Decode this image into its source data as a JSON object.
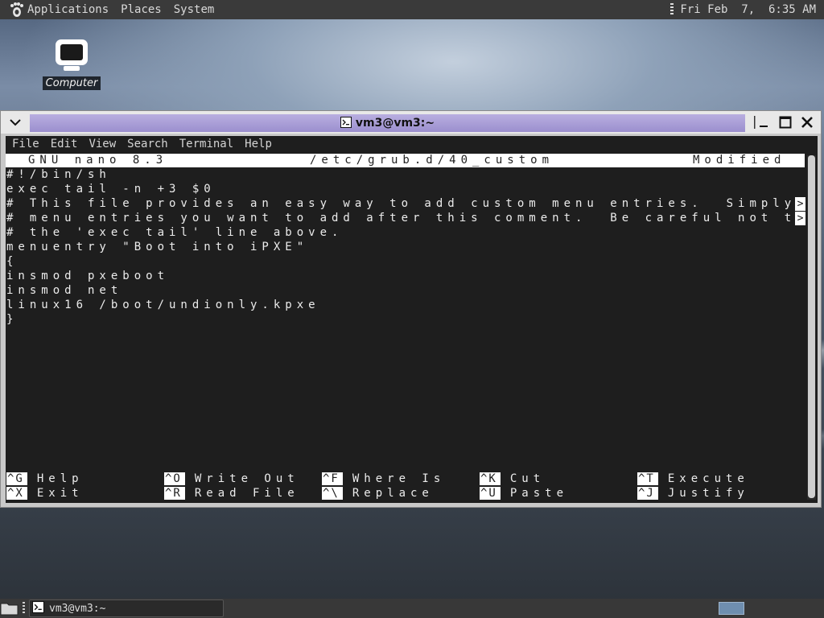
{
  "top_panel": {
    "menus": [
      "Applications",
      "Places",
      "System"
    ],
    "clock": "Fri Feb  7,  6:35 AM",
    "logo_icon": "gnome-foot-icon"
  },
  "desktop": {
    "icons": [
      {
        "label": "Computer",
        "icon": "computer-monitor-icon"
      }
    ]
  },
  "terminal": {
    "title": "vm3@vm3:~",
    "menus": [
      "File",
      "Edit",
      "View",
      "Search",
      "Terminal",
      "Help"
    ],
    "nano": {
      "version": "GNU nano 8.3",
      "filename": "/etc/grub.d/40_custom",
      "status": "Modified",
      "lines": [
        "#!/bin/sh",
        "exec tail -n +3 $0",
        "# This file provides an easy way to add custom menu entries.  Simply t",
        "# menu entries you want to add after this comment.  Be careful not to",
        "# the 'exec tail' line above.",
        "menuentry \"Boot into iPXE\"",
        "{",
        "insmod pxeboot",
        "insmod net",
        "linux16 /boot/undionly.kpxe",
        "}"
      ],
      "wrap_marker": ">",
      "shortcuts_row1": [
        {
          "key": "^G",
          "label": "Help"
        },
        {
          "key": "^O",
          "label": "Write Out"
        },
        {
          "key": "^F",
          "label": "Where Is"
        },
        {
          "key": "^K",
          "label": "Cut"
        },
        {
          "key": "^T",
          "label": "Execute"
        }
      ],
      "shortcuts_row2": [
        {
          "key": "^X",
          "label": "Exit"
        },
        {
          "key": "^R",
          "label": "Read File"
        },
        {
          "key": "^\\",
          "label": "Replace"
        },
        {
          "key": "^U",
          "label": "Paste"
        },
        {
          "key": "^J",
          "label": "Justify"
        }
      ]
    }
  },
  "taskbar": {
    "tasks": [
      {
        "label": "vm3@vm3:~",
        "icon": "terminal-icon"
      }
    ]
  },
  "colors": {
    "terminal_bg": "#1e1e1e",
    "terminal_fg": "#ececec",
    "titlebar_active": "#a99ed8",
    "workspace": "#6f8eaf"
  }
}
